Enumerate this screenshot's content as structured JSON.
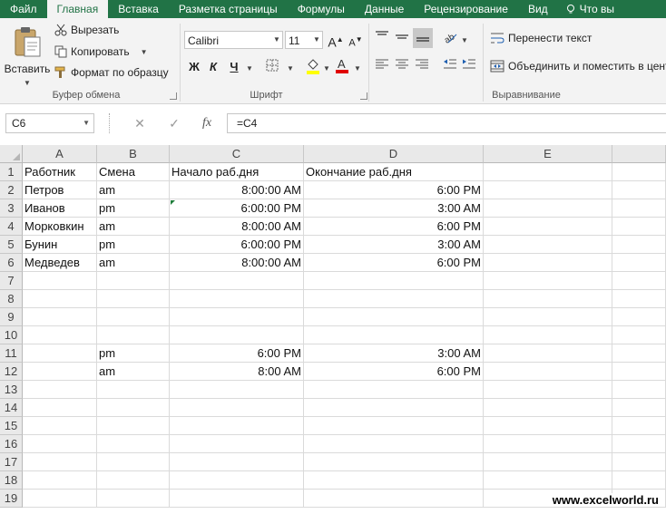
{
  "tabs": [
    {
      "label": "Файл",
      "active": false
    },
    {
      "label": "Главная",
      "active": true
    },
    {
      "label": "Вставка",
      "active": false
    },
    {
      "label": "Разметка страницы",
      "active": false
    },
    {
      "label": "Формулы",
      "active": false
    },
    {
      "label": "Данные",
      "active": false
    },
    {
      "label": "Рецензирование",
      "active": false
    },
    {
      "label": "Вид",
      "active": false
    }
  ],
  "tell_me": "Что вы",
  "clipboard": {
    "paste": "Вставить",
    "cut": "Вырезать",
    "copy": "Копировать",
    "format_painter": "Формат по образцу",
    "group": "Буфер обмена"
  },
  "font": {
    "name": "Calibri",
    "size": "11",
    "bold": "Ж",
    "italic": "К",
    "underline": "Ч",
    "group": "Шрифт"
  },
  "alignment": {
    "wrap": "Перенести текст",
    "merge": "Объединить и поместить в центре",
    "group": "Выравнивание"
  },
  "formula_bar": {
    "name_box": "C6",
    "fx": "fx",
    "formula": "=C4"
  },
  "columns": [
    "A",
    "B",
    "C",
    "D",
    "E"
  ],
  "rows": [
    [
      "Работник",
      "Смена",
      "Начало раб.дня",
      "Окончание раб.дня",
      ""
    ],
    [
      "Петров",
      "am",
      "8:00:00 AM",
      "6:00 PM",
      ""
    ],
    [
      "Иванов",
      "pm",
      "6:00:00 PM",
      "3:00 AM",
      ""
    ],
    [
      "Морковкин",
      "am",
      "8:00:00 AM",
      "6:00 PM",
      ""
    ],
    [
      "Бунин",
      "pm",
      "6:00:00 PM",
      "3:00 AM",
      ""
    ],
    [
      "Медведев",
      "am",
      "8:00:00 AM",
      "6:00 PM",
      ""
    ],
    [
      "",
      "",
      "",
      "",
      ""
    ],
    [
      "",
      "",
      "",
      "",
      ""
    ],
    [
      "",
      "",
      "",
      "",
      ""
    ],
    [
      "",
      "",
      "",
      "",
      ""
    ],
    [
      "",
      "pm",
      "6:00 PM",
      "3:00 AM",
      ""
    ],
    [
      "",
      "am",
      "8:00 AM",
      "6:00 PM",
      ""
    ],
    [
      "",
      "",
      "",
      "",
      ""
    ],
    [
      "",
      "",
      "",
      "",
      ""
    ],
    [
      "",
      "",
      "",
      "",
      ""
    ],
    [
      "",
      "",
      "",
      "",
      ""
    ],
    [
      "",
      "",
      "",
      "",
      ""
    ],
    [
      "",
      "",
      "",
      "",
      ""
    ],
    [
      "",
      "",
      "",
      "",
      ""
    ]
  ],
  "row_numbers": [
    "1",
    "2",
    "3",
    "4",
    "5",
    "6",
    "7",
    "8",
    "9",
    "10",
    "11",
    "12",
    "13",
    "14",
    "15",
    "16",
    "17",
    "18",
    "19"
  ],
  "watermark": "www.excelworld.ru",
  "colors": {
    "accent": "#217346",
    "font_color": "#e00000",
    "highlight": "#ffff00"
  }
}
